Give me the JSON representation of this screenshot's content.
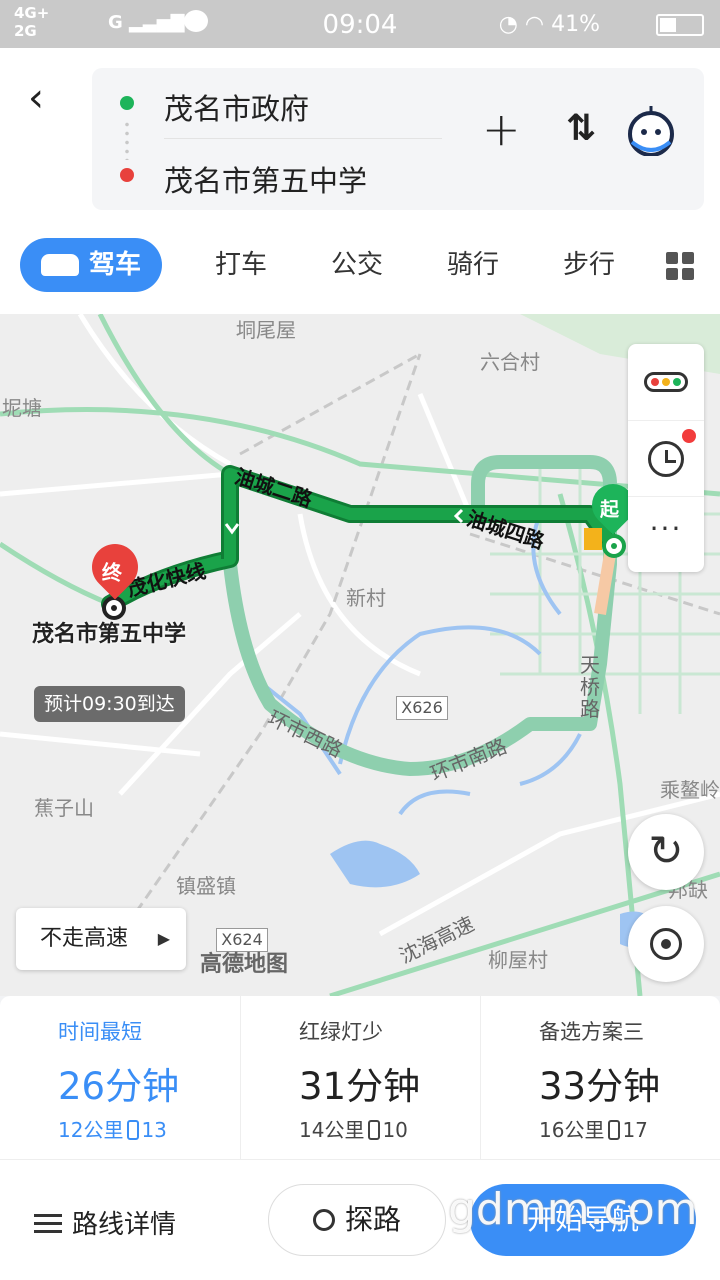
{
  "status_bar": {
    "network_top": "4G+",
    "network_bottom": "2G",
    "carrier_signal": "G",
    "time": "09:04",
    "battery": "41%"
  },
  "header": {
    "origin": "茂名市政府",
    "destination": "茂名市第五中学",
    "tabs": [
      {
        "label": "驾车",
        "active": true
      },
      {
        "label": "打车",
        "active": false
      },
      {
        "label": "公交",
        "active": false
      },
      {
        "label": "骑行",
        "active": false
      },
      {
        "label": "步行",
        "active": false
      }
    ]
  },
  "map": {
    "places": {
      "a": "垌尾屋",
      "b": "六合村",
      "c": "坭塘",
      "d": "新村",
      "e": "蕉子山",
      "f": "镇盛镇",
      "g": "柳屋村",
      "h": "乘鳌岭",
      "i": "邦缺"
    },
    "roads": {
      "r1": "茂化快线",
      "r2": "油城二路",
      "r3": "油城四路",
      "r4": "环市西路",
      "r5": "环市南路",
      "r6": "天桥路",
      "r7": "沈海高速",
      "x626": "X626",
      "x624": "X624"
    },
    "start_marker": "起",
    "end_marker": "终",
    "destination_label": "茂名市第五中学",
    "eta": "预计09:30到达",
    "avoid_highway": "不走高速",
    "brand": "高德地图",
    "side_more": "···",
    "colors": {
      "route_primary": "#1aa34a",
      "route_alt": "#8ecfae",
      "water": "#9ec4f2"
    }
  },
  "route_options": [
    {
      "label": "时间最短",
      "time": "26分钟",
      "distance": "12公里",
      "lights": "13",
      "selected": true
    },
    {
      "label": "红绿灯少",
      "time": "31分钟",
      "distance": "14公里",
      "lights": "10",
      "selected": false
    },
    {
      "label": "备选方案三",
      "time": "33分钟",
      "distance": "16公里",
      "lights": "17",
      "selected": false
    }
  ],
  "bottom_bar": {
    "details": "路线详情",
    "explore": "探路",
    "start_nav": "开始导航",
    "watermark": "gdmm.com"
  }
}
